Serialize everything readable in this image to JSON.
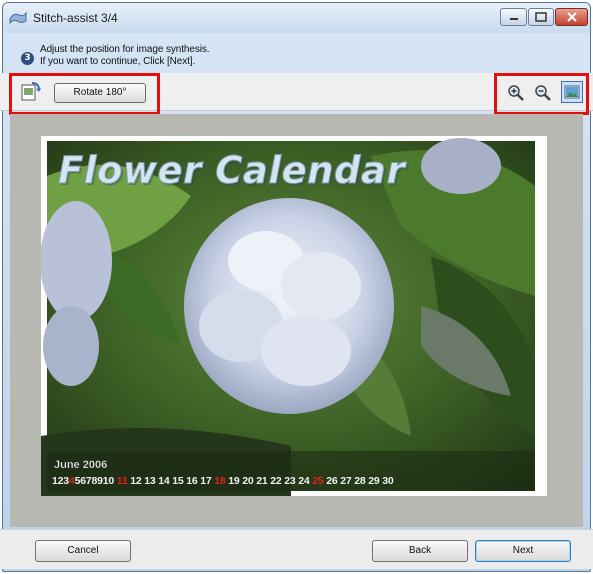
{
  "window": {
    "title": "Stitch-assist 3/4"
  },
  "info": {
    "line1": "Adjust the position for image synthesis.",
    "line2": "If you want to continue, Click [Next]."
  },
  "toolbar": {
    "rotate_label": "Rotate 180°",
    "icons": [
      "rotate-icon",
      "zoom-in-icon",
      "zoom-out-icon",
      "fit-to-window-icon"
    ]
  },
  "preview": {
    "title": "Flower Calendar",
    "month": "June 2006",
    "days": [
      "1",
      "2",
      "3",
      "4",
      "5",
      "6",
      "7",
      "8",
      "9",
      "10",
      "11",
      "12",
      "13",
      "14",
      "15",
      "16",
      "17",
      "18",
      "19",
      "20",
      "21",
      "22",
      "23",
      "24",
      "25",
      "26",
      "27",
      "28",
      "29",
      "30"
    ],
    "red_days": [
      "4",
      "11",
      "18",
      "25"
    ]
  },
  "footer": {
    "cancel_label": "Cancel",
    "back_label": "Back",
    "next_label": "Next"
  },
  "colors": {
    "highlight": "#e01010",
    "canvas": "#b8b8b3",
    "title_bar": "#c9dbee"
  }
}
